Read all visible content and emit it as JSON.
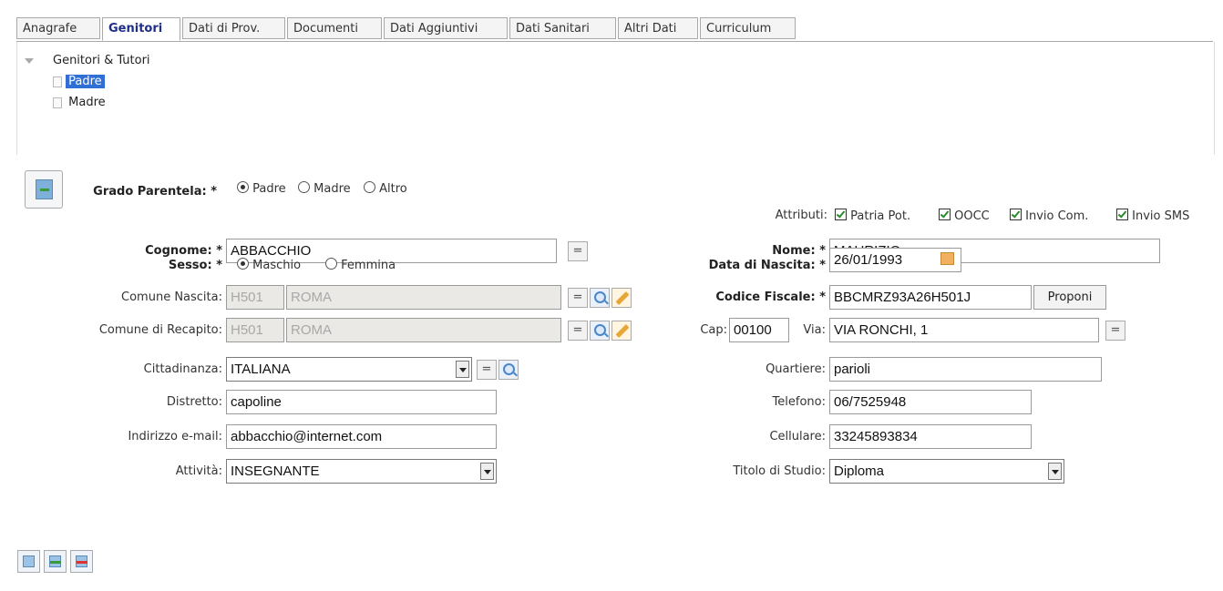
{
  "tabs": [
    "Anagrafe",
    "Genitori",
    "Dati di Prov.",
    "Documenti",
    "Dati Aggiuntivi",
    "Dati Sanitari",
    "Altri Dati",
    "Curriculum"
  ],
  "tree": {
    "root": "Genitori & Tutori",
    "items": [
      "Padre",
      "Madre"
    ]
  },
  "form": {
    "grado_label": "Grado Parentela: *",
    "grado_options": [
      "Padre",
      "Madre",
      "Altro"
    ],
    "attributi_label": "Attributi:",
    "attributi": [
      "Patria Pot.",
      "OOCC",
      "Invio Com.",
      "Invio SMS"
    ],
    "cognome_label": "Cognome: *",
    "cognome": "ABBACCHIO",
    "nome_label": "Nome: *",
    "nome": "MAURIZIO",
    "sesso_label": "Sesso: *",
    "sesso_options": [
      "Maschio",
      "Femmina"
    ],
    "nascita_label": "Data di Nascita: *",
    "nascita": "26/01/1993",
    "comune_nascita_label": "Comune Nascita:",
    "comune_nascita_code": "H501",
    "comune_nascita_name": "ROMA",
    "cf_label": "Codice Fiscale: *",
    "cf": "BBCMRZ93A26H501J",
    "proponi": "Proponi",
    "comune_recapito_label": "Comune di Recapito:",
    "comune_recapito_code": "H501",
    "comune_recapito_name": "ROMA",
    "cap_label": "Cap:",
    "cap": "00100",
    "via_label": "Via:",
    "via": "VIA RONCHI, 1",
    "cittadinanza_label": "Cittadinanza:",
    "cittadinanza": "ITALIANA",
    "quartiere_label": "Quartiere:",
    "quartiere": "parioli",
    "distretto_label": "Distretto:",
    "distretto": "capoline",
    "telefono_label": "Telefono:",
    "telefono": "06/7525948",
    "email_label": "Indirizzo e-mail:",
    "email": "abbacchio@internet.com",
    "cellulare_label": "Cellulare:",
    "cellulare": "33245893834",
    "attivita_label": "Attività:",
    "attivita": "INSEGNANTE",
    "titolo_label": "Titolo di Studio:",
    "titolo": "Diploma",
    "eq": "="
  }
}
